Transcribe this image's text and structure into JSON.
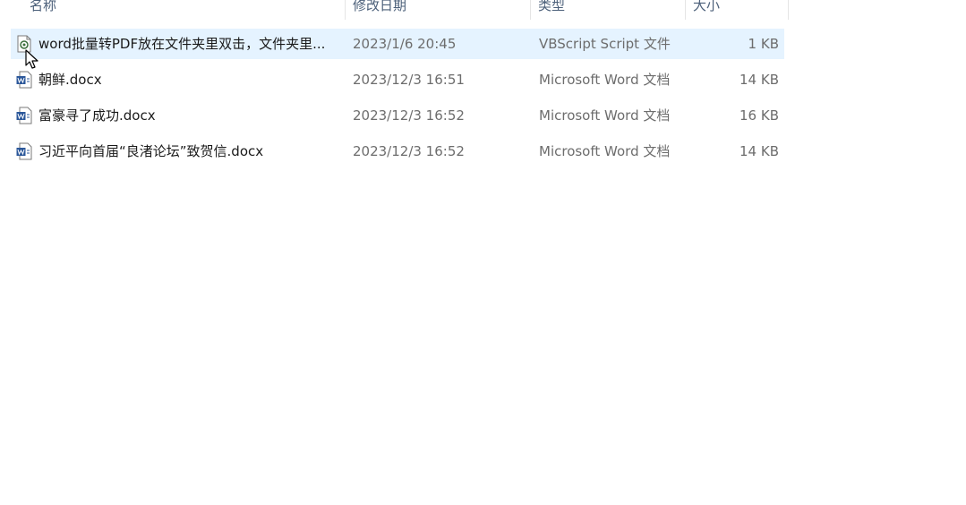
{
  "columns": {
    "name": "名称",
    "date": "修改日期",
    "type": "类型",
    "size": "大小"
  },
  "files": [
    {
      "name": "word批量转PDF放在文件夹里双击，文件夹里...",
      "date": "2023/1/6 20:45",
      "type": "VBScript Script 文件",
      "size": "1 KB",
      "icon": "vbscript-file-icon",
      "selected": true
    },
    {
      "name": "朝鲜.docx",
      "date": "2023/12/3 16:51",
      "type": "Microsoft Word 文档",
      "size": "14 KB",
      "icon": "word-document-icon",
      "selected": false
    },
    {
      "name": "富豪寻了成功.docx",
      "date": "2023/12/3 16:52",
      "type": "Microsoft Word 文档",
      "size": "16 KB",
      "icon": "word-document-icon",
      "selected": false
    },
    {
      "name": "习近平向首届“良渚论坛”致贺信.docx",
      "date": "2023/12/3 16:52",
      "type": "Microsoft Word 文档",
      "size": "14 KB",
      "icon": "word-document-icon",
      "selected": false
    }
  ],
  "colors": {
    "selection": "#e5f3ff",
    "word_blue": "#2b579a"
  }
}
